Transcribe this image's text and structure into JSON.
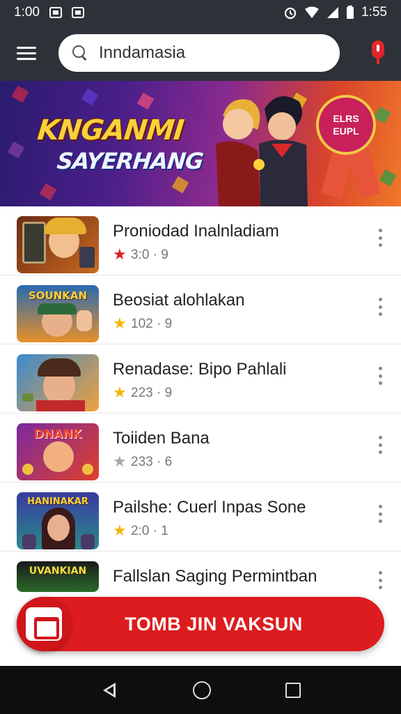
{
  "status_bar": {
    "time_left": "1:00",
    "time_right": "1:55"
  },
  "search": {
    "query": "Inndamasia"
  },
  "banner": {
    "logo_line1": "KNGANMI",
    "logo_line2": "SAYERHANG",
    "badge_line1": "ELRS",
    "badge_line2": "EUPL"
  },
  "games": [
    {
      "title": "Proniodad Inalnladiam",
      "rating": "3:0 · 9",
      "star_color": "#d81f26",
      "thumb_title": ""
    },
    {
      "title": "Beosiat alohlakan",
      "rating": "102 · 9",
      "star_color": "#f2b705",
      "thumb_title": "SOUNKAN"
    },
    {
      "title": "Renadase: Bipo Pahlali",
      "rating": "223 · 9",
      "star_color": "#f2b705",
      "thumb_title": ""
    },
    {
      "title": "Toiiden Bana",
      "rating": "233 · 6",
      "star_color": "#a8a8a8",
      "thumb_title": "DNANK"
    },
    {
      "title": "Pailshe: Cuerl Inpas Sone",
      "rating": "2:0 · 1",
      "star_color": "#f2b705",
      "thumb_title": "HANINAKAR"
    },
    {
      "title": "Fallslan Saging Permintban",
      "rating": "",
      "star_color": "#f2b705",
      "thumb_title": "UVANKIAN"
    }
  ],
  "cta": {
    "label": "TOMB JIN VAKSUN"
  },
  "colors": {
    "app_bar": "#2d3238",
    "accent": "#dd1c1f"
  }
}
